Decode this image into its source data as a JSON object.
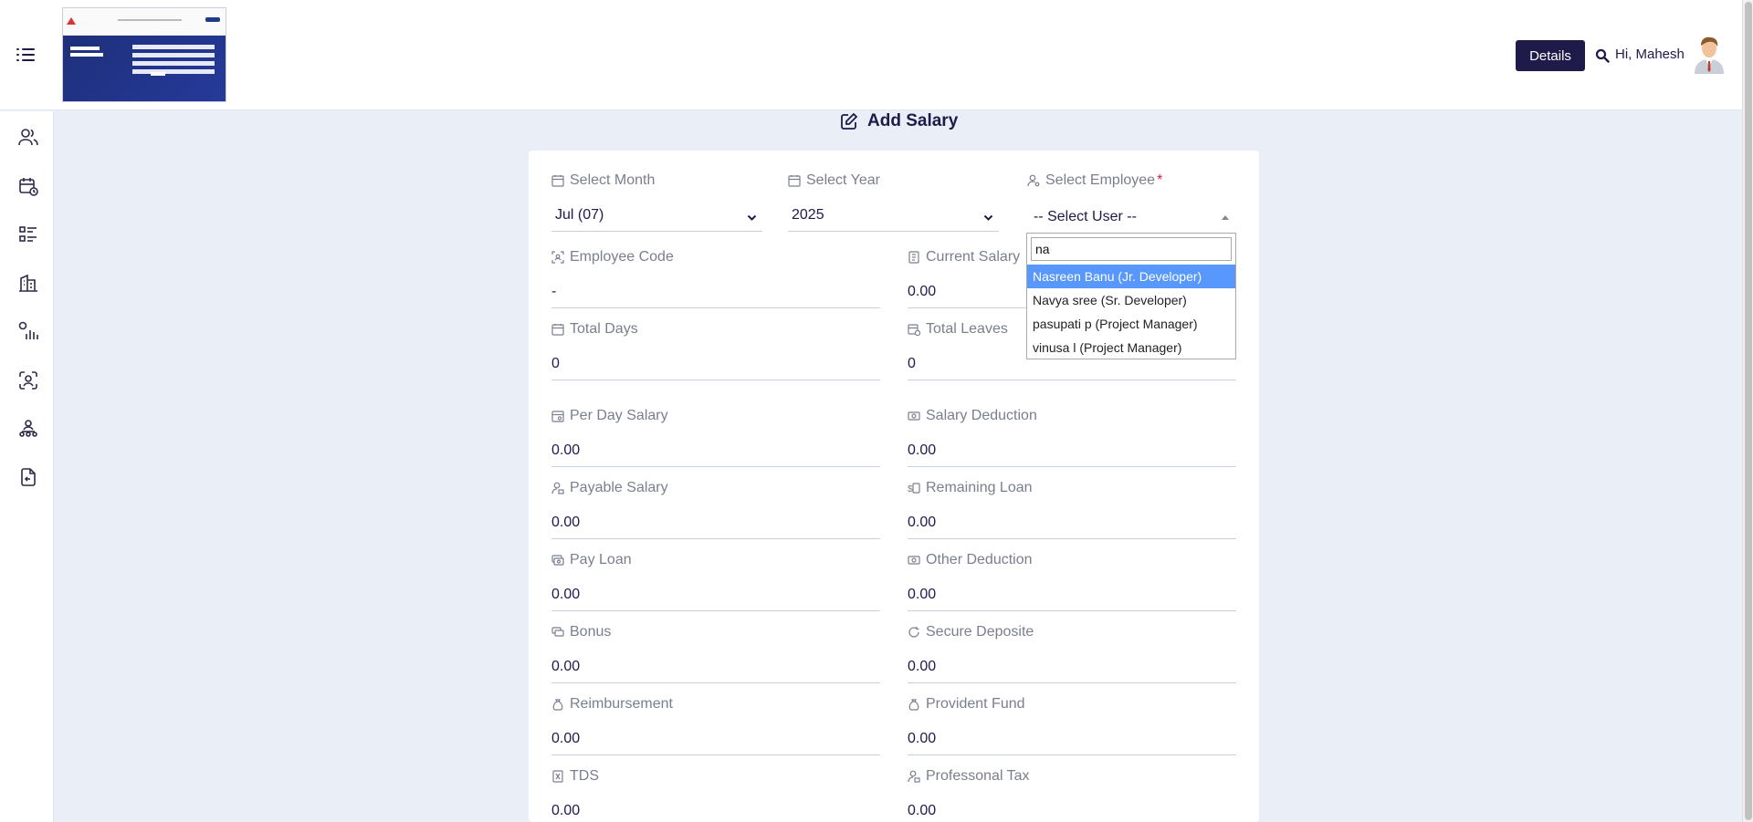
{
  "header": {
    "details_label": "Details",
    "greeting": "Hi, Mahesh"
  },
  "sidebar": {
    "items": [
      {
        "icon": "users-icon"
      },
      {
        "icon": "calendar-clock-icon"
      },
      {
        "icon": "list-icon"
      },
      {
        "icon": "building-icon"
      },
      {
        "icon": "chart-icon"
      },
      {
        "icon": "scan-face-icon"
      },
      {
        "icon": "org-chart-icon"
      },
      {
        "icon": "file-import-icon"
      }
    ]
  },
  "page": {
    "title": "Add Salary"
  },
  "form": {
    "select_month": {
      "label": "Select Month",
      "value": "Jul (07)"
    },
    "select_year": {
      "label": "Select Year",
      "value": "2025"
    },
    "select_employee": {
      "label": "Select Employee",
      "required_mark": "*",
      "value": "-- Select User --"
    },
    "employee_code": {
      "label": "Employee Code",
      "value": "-"
    },
    "current_salary": {
      "label": "Current Salary",
      "value": "0.00"
    },
    "total_days": {
      "label": "Total Days",
      "value": "0"
    },
    "total_leaves": {
      "label": "Total Leaves",
      "value": "0"
    },
    "per_day_salary": {
      "label": "Per Day Salary",
      "value": "0.00"
    },
    "salary_deduction": {
      "label": "Salary Deduction",
      "value": "0.00"
    },
    "payable_salary": {
      "label": "Payable Salary",
      "value": "0.00"
    },
    "remaining_loan": {
      "label": "Remaining Loan",
      "value": "0.00"
    },
    "pay_loan": {
      "label": "Pay Loan",
      "value": "0.00"
    },
    "other_deduction": {
      "label": "Other Deduction",
      "value": "0.00"
    },
    "bonus": {
      "label": "Bonus",
      "value": "0.00"
    },
    "secure_deposite": {
      "label": "Secure Deposite",
      "value": "0.00"
    },
    "reimbursement": {
      "label": "Reimbursement",
      "value": "0.00"
    },
    "provident_fund": {
      "label": "Provident Fund",
      "value": "0.00"
    },
    "tds": {
      "label": "TDS",
      "value": "0.00"
    },
    "professional_tax": {
      "label": "Professonal Tax",
      "value": "0.00"
    }
  },
  "employee_dropdown": {
    "search_value": "na",
    "options": [
      "Nasreen Banu (Jr. Developer)",
      "Navya sree (Sr. Developer)",
      "pasupati p (Project Manager)",
      "vinusa l (Project Manager)"
    ],
    "highlighted_index": 0
  }
}
